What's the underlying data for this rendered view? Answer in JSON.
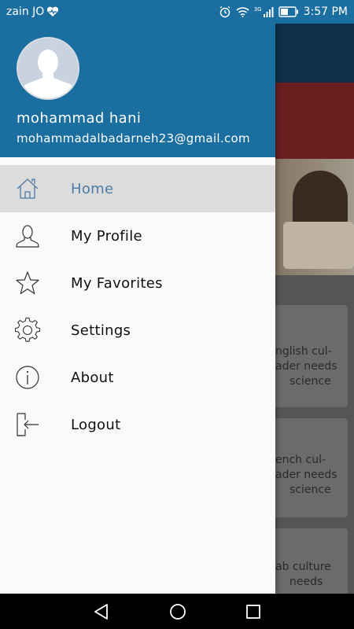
{
  "status_bar": {
    "carrier": "zain JO",
    "network_type": "3G",
    "time": "3:57 PM",
    "icons": [
      "heart-pulse-icon",
      "alarm-icon",
      "wifi-icon",
      "signal-icon",
      "battery-icon"
    ]
  },
  "drawer": {
    "header": {
      "user_name": "mohammad hani",
      "email": "mohammadalbadarneh23@gmail.com",
      "avatar_icon": "avatar-placeholder-icon"
    },
    "items": [
      {
        "label": "Home",
        "icon": "home-icon",
        "active": true
      },
      {
        "label": "My Profile",
        "icon": "person-icon",
        "active": false
      },
      {
        "label": "My Favorites",
        "icon": "star-icon",
        "active": false
      },
      {
        "label": "Settings",
        "icon": "gear-icon",
        "active": false
      },
      {
        "label": "About",
        "icon": "info-icon",
        "active": false
      },
      {
        "label": "Logout",
        "icon": "logout-icon",
        "active": false
      }
    ]
  },
  "background": {
    "cards": [
      {
        "lines": [
          "nglish cul-",
          "ader needs",
          "science"
        ]
      },
      {
        "lines": [
          "ench cul-",
          "ader needs",
          "science"
        ]
      },
      {
        "lines": [
          "ab culture",
          "needs"
        ]
      }
    ]
  },
  "nav_bar": {
    "icons": [
      "back-icon",
      "home-circle-icon",
      "recents-icon"
    ]
  },
  "colors": {
    "primary": "#1a6fa0",
    "active_text": "#4e7aa3",
    "active_bg": "#dcdcdc"
  }
}
